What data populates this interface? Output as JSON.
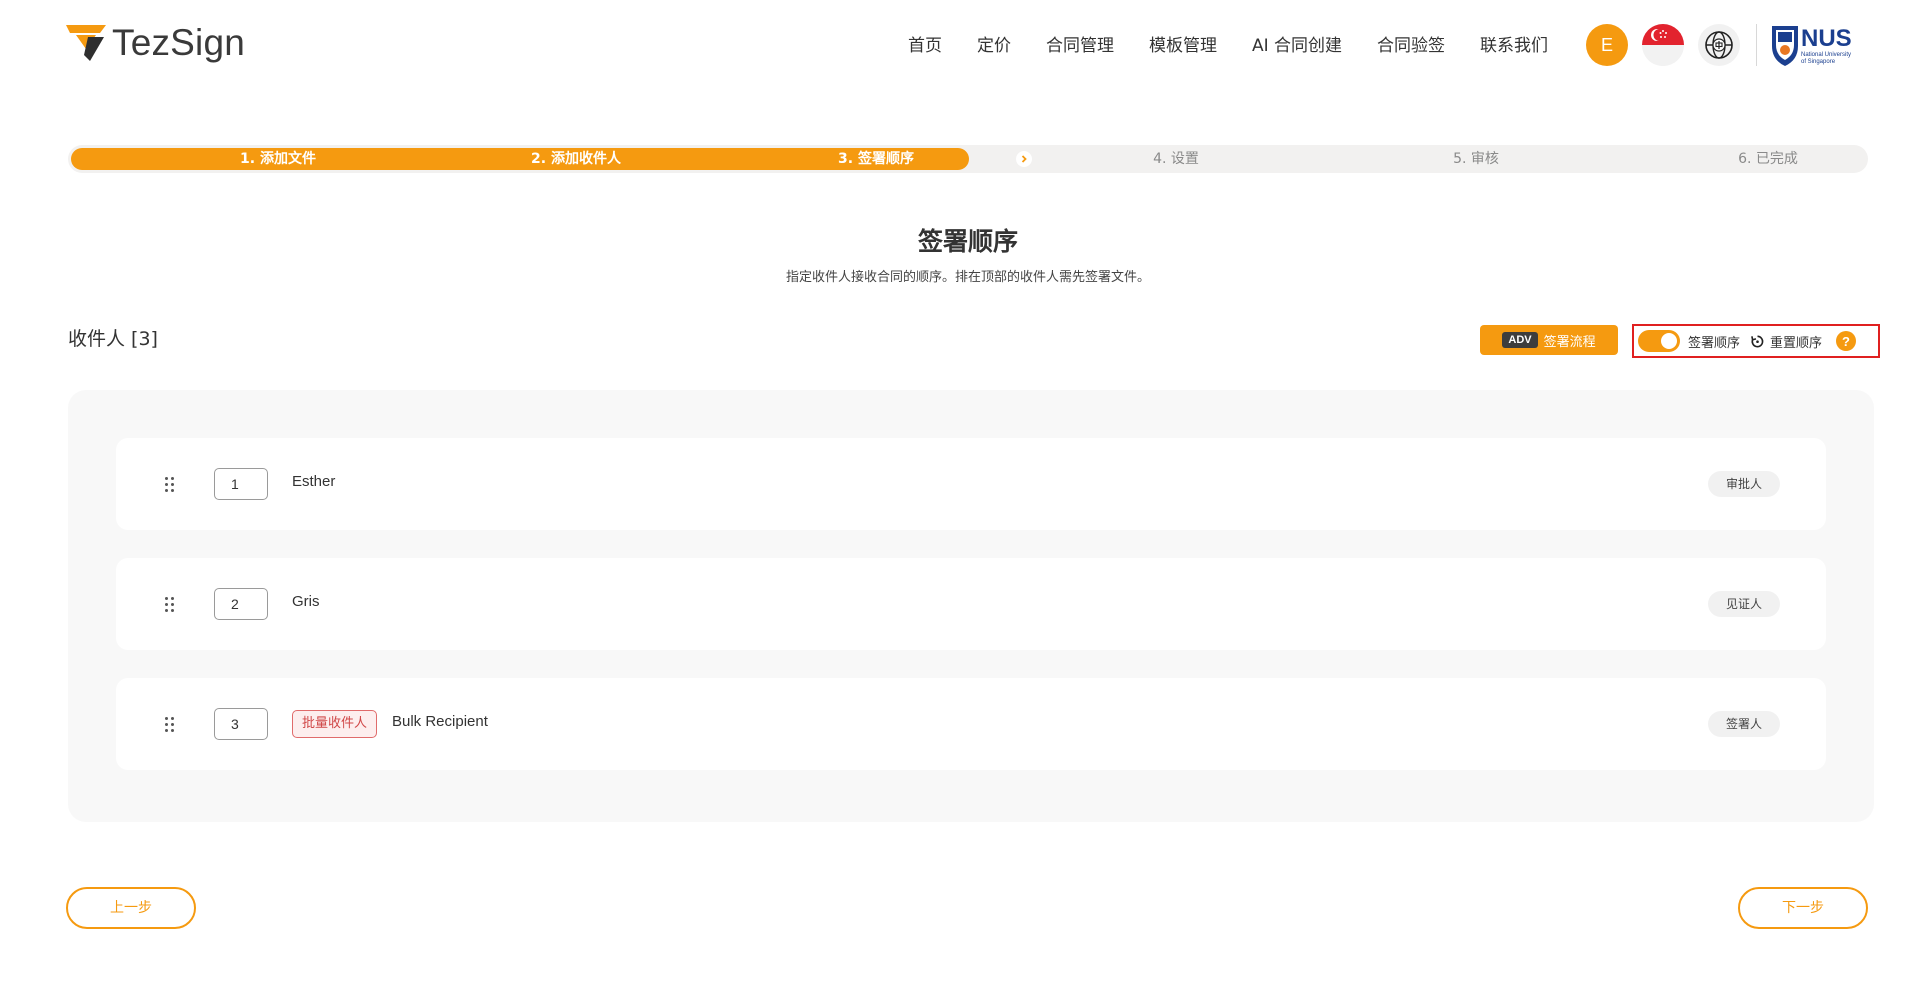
{
  "brand": {
    "name": "TezSign",
    "accent": "#F59A10"
  },
  "nav": {
    "items": [
      "首页",
      "定价",
      "合同管理",
      "模板管理",
      "AI 合同创建",
      "合同验签",
      "联系我们"
    ]
  },
  "user": {
    "initial": "E"
  },
  "partner": {
    "name": "NUS",
    "sub1": "National University",
    "sub2": "of Singapore"
  },
  "stepper": {
    "steps": [
      {
        "label": "1. 添加文件",
        "state": "done"
      },
      {
        "label": "2. 添加收件人",
        "state": "done"
      },
      {
        "label": "3. 签署顺序",
        "state": "current"
      },
      {
        "label": "4. 设置",
        "state": "todo"
      },
      {
        "label": "5. 审核",
        "state": "todo"
      },
      {
        "label": "6. 已完成",
        "state": "todo"
      }
    ]
  },
  "page": {
    "title": "签署顺序",
    "subtitle": "指定收件人接收合同的顺序。排在顶部的收件人需先签署文件。"
  },
  "recipients_header": {
    "heading": "收件人 [3]",
    "adv_badge": "ADV",
    "adv_label": "签署流程",
    "toggle_label": "签署顺序",
    "toggle_on": true,
    "reset_label": "重置顺序",
    "help": "?"
  },
  "recipients": [
    {
      "order": "1",
      "name": "Esther",
      "tag": "",
      "role": "审批人"
    },
    {
      "order": "2",
      "name": "Gris",
      "tag": "",
      "role": "见证人"
    },
    {
      "order": "3",
      "name": "Bulk Recipient",
      "tag": "批量收件人",
      "role": "签署人"
    }
  ],
  "footer": {
    "prev": "上一步",
    "next": "下一步"
  }
}
